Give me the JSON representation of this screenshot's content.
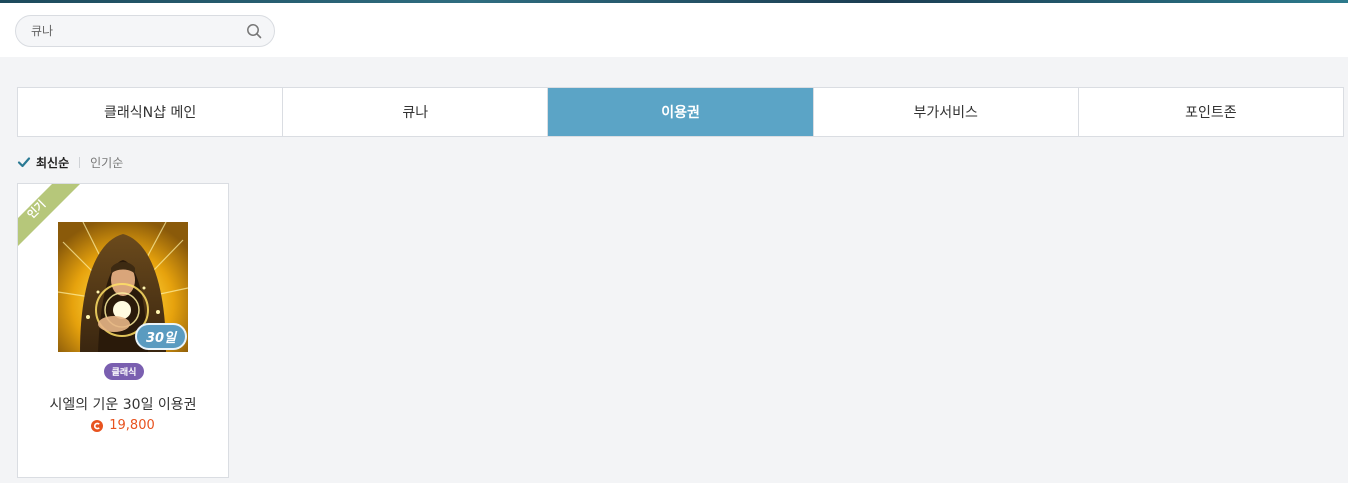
{
  "search": {
    "placeholder": "큐나"
  },
  "tabs": [
    {
      "label": "클래식N샵 메인",
      "active": false
    },
    {
      "label": "큐나",
      "active": false
    },
    {
      "label": "이용권",
      "active": true
    },
    {
      "label": "부가서비스",
      "active": false
    },
    {
      "label": "포인트존",
      "active": false
    }
  ],
  "sort": {
    "active": "최신순",
    "other": "인기순"
  },
  "products": [
    {
      "ribbon": "인기",
      "days_badge": "30일",
      "tag": "클래식",
      "name": "시엘의 기운 30일 이용권",
      "price": "19,800"
    }
  ],
  "colors": {
    "accent_tab": "#5ba4c6",
    "ribbon": "#b6c77a",
    "tag": "#7a5fb0",
    "price": "#e8531f",
    "days_badge": "#5a9bc0"
  }
}
